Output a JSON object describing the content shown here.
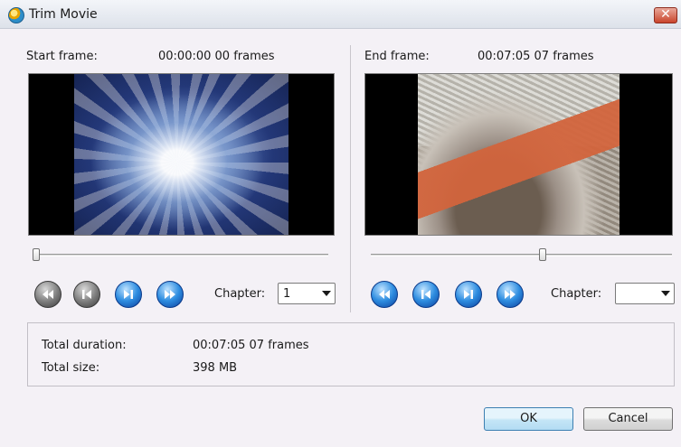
{
  "window": {
    "title": "Trim Movie",
    "close_glyph": "✕"
  },
  "start": {
    "label": "Start frame:",
    "time": "00:00:00 00 frames",
    "slider_position": 0.0,
    "chapter_label": "Chapter:",
    "chapter_value": "1"
  },
  "end": {
    "label": "End frame:",
    "time": "00:07:05 07 frames",
    "slider_position": 0.57,
    "chapter_label": "Chapter:",
    "chapter_value": ""
  },
  "info": {
    "duration_label": "Total duration:",
    "duration_value": "00:07:05 07 frames",
    "size_label": "Total size:",
    "size_value": "398 MB"
  },
  "buttons": {
    "ok": "OK",
    "cancel": "Cancel"
  },
  "colors": {
    "accent": "#2e8de0",
    "disabled": "#7a7a7a",
    "close": "#c9452c"
  }
}
